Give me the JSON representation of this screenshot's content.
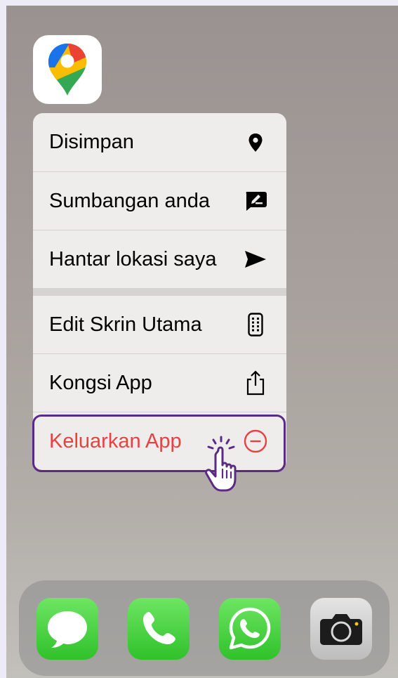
{
  "colors": {
    "danger": "#e7423f",
    "highlight": "#5a2a84",
    "menu_bg": "#efedec",
    "ios_green": "#34c759"
  },
  "app_icon": {
    "icon": "google-maps-icon"
  },
  "menu": {
    "items": [
      {
        "label": "Disimpan",
        "icon": "map-pin-icon"
      },
      {
        "label": "Sumbangan anda",
        "icon": "edit-review-icon"
      },
      {
        "label": "Hantar lokasi saya",
        "icon": "send-arrow-icon"
      },
      {
        "label": "Edit Skrin Utama",
        "icon": "phone-screen-icon"
      },
      {
        "label": "Kongsi App",
        "icon": "share-icon"
      },
      {
        "label": "Keluarkan App",
        "icon": "minus-circle-icon"
      }
    ]
  },
  "dock": {
    "apps": [
      {
        "icon": "messages-icon"
      },
      {
        "icon": "phone-icon"
      },
      {
        "icon": "whatsapp-icon"
      },
      {
        "icon": "camera-icon"
      }
    ]
  }
}
